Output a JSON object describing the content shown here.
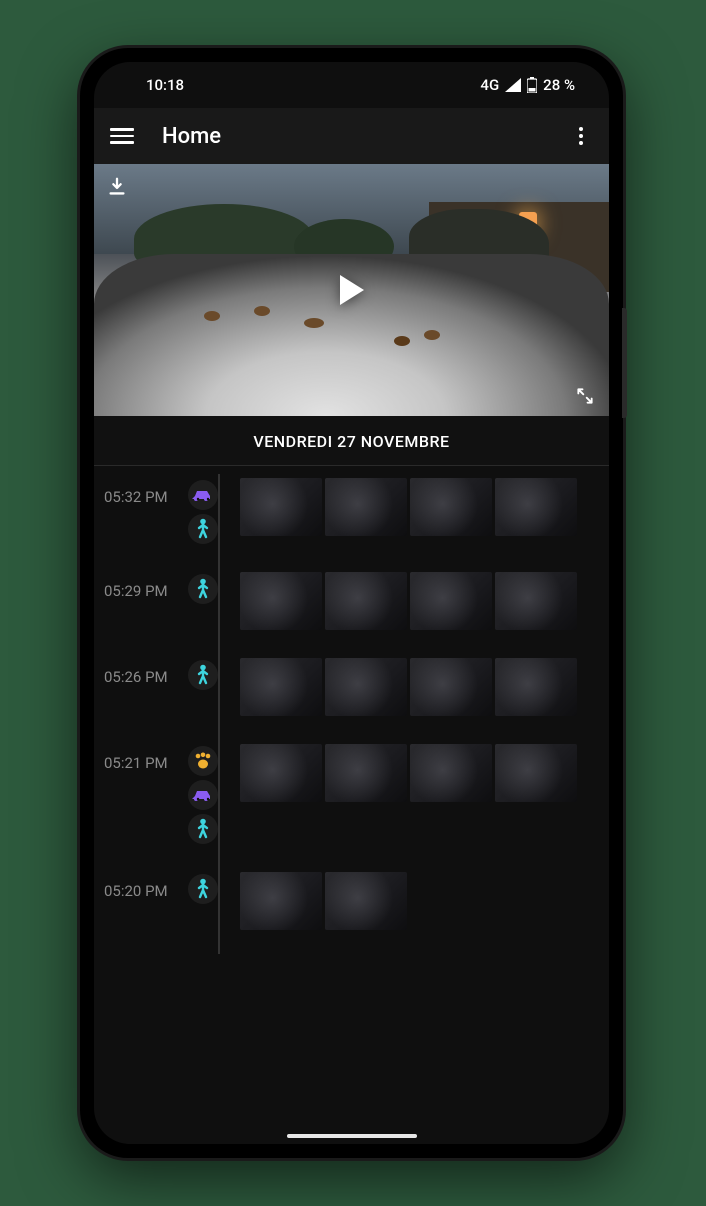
{
  "status": {
    "time": "10:18",
    "network": "4G",
    "battery": "28 %"
  },
  "header": {
    "title": "Home"
  },
  "date_header": "VENDREDI 27 NOVEMBRE",
  "icon_colors": {
    "person": "#3dd4de",
    "vehicle": "#8a5cf0",
    "pet": "#f0b030"
  },
  "events": [
    {
      "time": "05:32 PM",
      "types": [
        "vehicle",
        "person"
      ],
      "thumbs": 4
    },
    {
      "time": "05:29 PM",
      "types": [
        "person"
      ],
      "thumbs": 4
    },
    {
      "time": "05:26 PM",
      "types": [
        "person"
      ],
      "thumbs": 4
    },
    {
      "time": "05:21 PM",
      "types": [
        "pet",
        "vehicle",
        "person"
      ],
      "thumbs": 4
    },
    {
      "time": "05:20 PM",
      "types": [
        "person"
      ],
      "thumbs": 2
    }
  ]
}
